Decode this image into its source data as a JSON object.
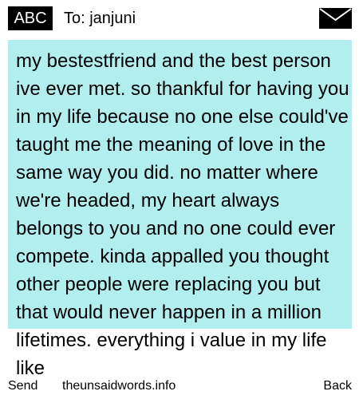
{
  "header": {
    "badge_label": "ABC",
    "to_label": "To: janjuni",
    "icon": "envelope-icon"
  },
  "message": {
    "body": "my bestestfriend and the best person ive ever met. so thankful for having you in my life because no one else could've taught me the meaning of love in the same way you did. no matter where we're headed, my heart always belongs to you and no one could ever compete. kinda appalled you thought other people were replacing you but that would never happen in a million lifetimes. everything i value in my life like"
  },
  "footer": {
    "send_label": "Send",
    "site_label": "theunsaidwords.info",
    "back_label": "Back"
  },
  "colors": {
    "message_background": "#b2eeee",
    "badge_background": "#000000"
  }
}
